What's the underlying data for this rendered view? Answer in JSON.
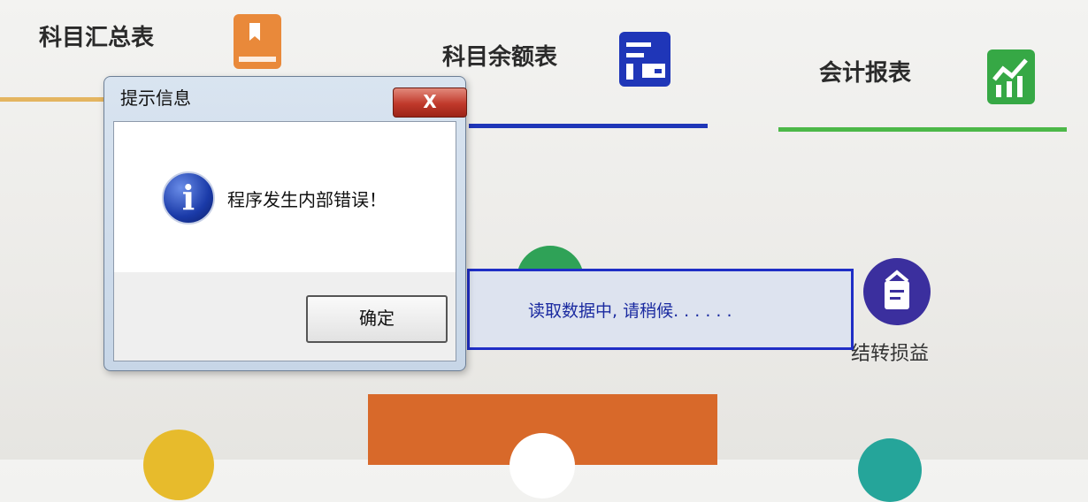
{
  "tabs": [
    {
      "label": "科目汇总表",
      "color": "#e8a33a"
    },
    {
      "label": "科目余额表",
      "color": "#1f36b8"
    },
    {
      "label": "会计报表",
      "color": "#36a845"
    }
  ],
  "functions": {
    "transfer_profit_loss": {
      "label": "结转损益",
      "icon": "clipboard-icon"
    }
  },
  "dialog": {
    "title": "提示信息",
    "close_label": "X",
    "message": "程序发生内部错误！",
    "ok_label": "确定",
    "icon": "info-icon"
  },
  "loading": {
    "text": "读取数据中, 请稍候. . . . . ."
  }
}
